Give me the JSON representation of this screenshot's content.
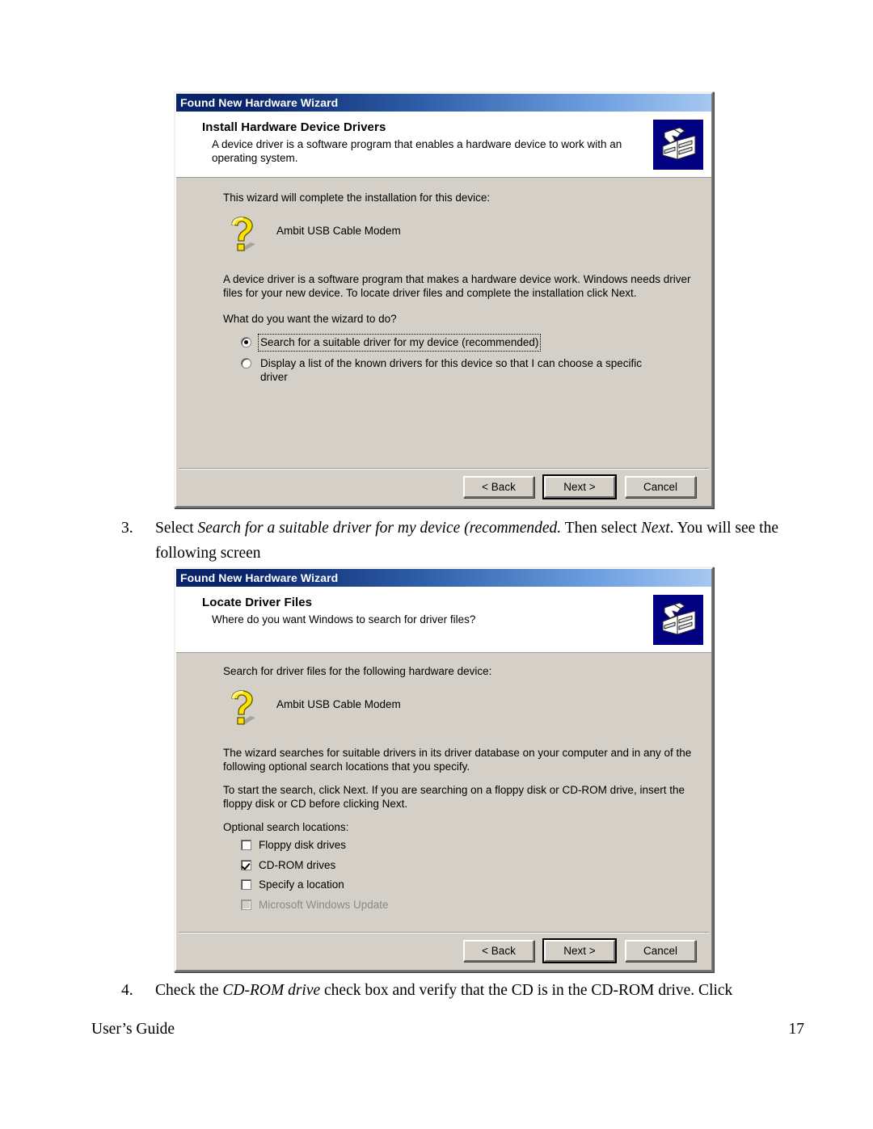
{
  "document": {
    "footer_left": "User’s Guide",
    "footer_page": "17",
    "step3": {
      "number": "3.",
      "part1": "Select ",
      "italic1": "Search for a suitable driver for my device (recommended.",
      "part2": "  Then select ",
      "italic2": "Next",
      "part3": ".  You will see the following screen"
    },
    "step4": {
      "number": "4.",
      "part1": "Check the ",
      "italic1": "CD-ROM drive",
      "part2": " check box and verify that the CD is in the CD-ROM drive.  Click"
    }
  },
  "dialog1": {
    "title": "Found New Hardware Wizard",
    "header_title": "Install Hardware Device Drivers",
    "header_sub": "A device driver is a software program that enables a hardware device to work with an operating system.",
    "intro": "This wizard will complete the installation for this device:",
    "device_name": "Ambit USB Cable Modem",
    "explain": "A device driver is a software program that makes a hardware device work. Windows needs driver files for your new device. To locate driver files and complete the installation click Next.",
    "question": "What do you want the wizard to do?",
    "options": [
      {
        "label": "Search for a suitable driver for my device (recommended)",
        "selected": true,
        "focused": true
      },
      {
        "label": "Display a list of the known drivers for this device so that I can choose a specific driver",
        "selected": false,
        "focused": false
      }
    ],
    "buttons": {
      "back": "< Back",
      "next": "Next >",
      "cancel": "Cancel"
    }
  },
  "dialog2": {
    "title": "Found New Hardware Wizard",
    "header_title": "Locate Driver Files",
    "header_sub": "Where do you want Windows to search for driver files?",
    "intro": "Search for driver files for the following hardware device:",
    "device_name": "Ambit USB Cable Modem",
    "explain1": "The wizard searches for suitable drivers in its driver database on your computer and in any of the following optional search locations that you specify.",
    "explain2": "To start the search, click Next. If you are searching on a floppy disk or CD-ROM drive, insert the floppy disk or CD before clicking Next.",
    "locations_heading": "Optional search locations:",
    "locations": [
      {
        "label": "Floppy disk drives",
        "checked": false,
        "disabled": false
      },
      {
        "label": "CD-ROM drives",
        "checked": true,
        "disabled": false
      },
      {
        "label": "Specify a location",
        "checked": false,
        "disabled": false
      },
      {
        "label": "Microsoft Windows Update",
        "checked": false,
        "disabled": true
      }
    ],
    "buttons": {
      "back": "< Back",
      "next": "Next >",
      "cancel": "Cancel"
    }
  },
  "colors": {
    "titlebar_start": "#0a246a",
    "titlebar_end": "#a6c8f0",
    "dialog_face": "#d4d0c8",
    "icon_navy": "#000080",
    "qmark_yellow": "#ffe000"
  }
}
